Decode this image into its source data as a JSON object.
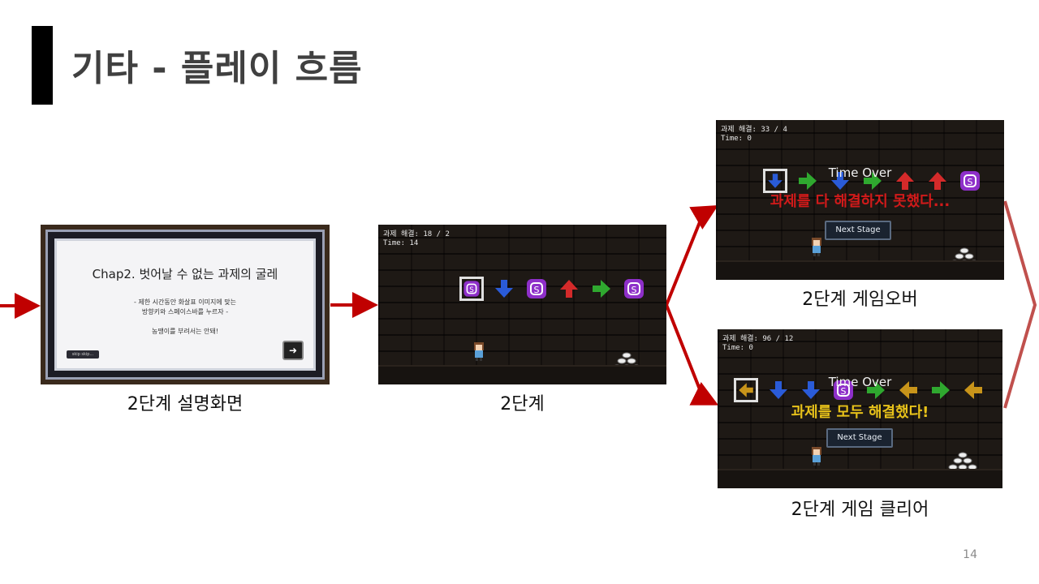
{
  "slide": {
    "title": "기타 - 플레이 흐름",
    "page_number": "14"
  },
  "explain_screen": {
    "heading": "Chap2. 벗어날 수 없는 과제의 굴레",
    "line1": "- 제한 시간동안 화살표 이미지에 맞는",
    "line2": "방향키와 스페이스바를 누르자 -",
    "line3": "농땡이를 부려서는 안돼!",
    "skip_label": "skip skip...",
    "next_label": "➜",
    "caption": "2단계 설명화면"
  },
  "stage_screen": {
    "hud_tasks": "과제 해결: 18 / 2",
    "hud_time": "Time: 14",
    "caption": "2단계",
    "sequence": [
      "s",
      "down",
      "s",
      "up",
      "right",
      "s"
    ]
  },
  "gameover_screen": {
    "hud_tasks": "과제 해결: 33 / 4",
    "hud_time": "Time: 0",
    "time_over": "Time Over",
    "message": "과제를 다 해결하지 못했다...",
    "message_color": "#d11a1a",
    "next_label": "Next Stage",
    "caption": "2단계 게임오버",
    "sequence": [
      "down",
      "right",
      "down",
      "right",
      "up",
      "up",
      "s"
    ]
  },
  "clear_screen": {
    "hud_tasks": "과제 해결: 96 / 12",
    "hud_time": "Time: 0",
    "time_over": "Time Over",
    "message": "과제를 모두 해결했다!",
    "message_color": "#e8c21a",
    "next_label": "Next Stage",
    "caption": "2단계 게임 클리어",
    "sequence": [
      "left",
      "down",
      "down",
      "s",
      "right",
      "left",
      "right",
      "left"
    ]
  },
  "colors": {
    "arrow_red": "#c00000",
    "bracket": "#c0504d",
    "tile_purple": "#8e2fc9",
    "tile_blue": "#2a5bd8",
    "tile_red": "#d42a2a",
    "tile_green": "#2fa82f",
    "tile_gold": "#c8941a"
  }
}
